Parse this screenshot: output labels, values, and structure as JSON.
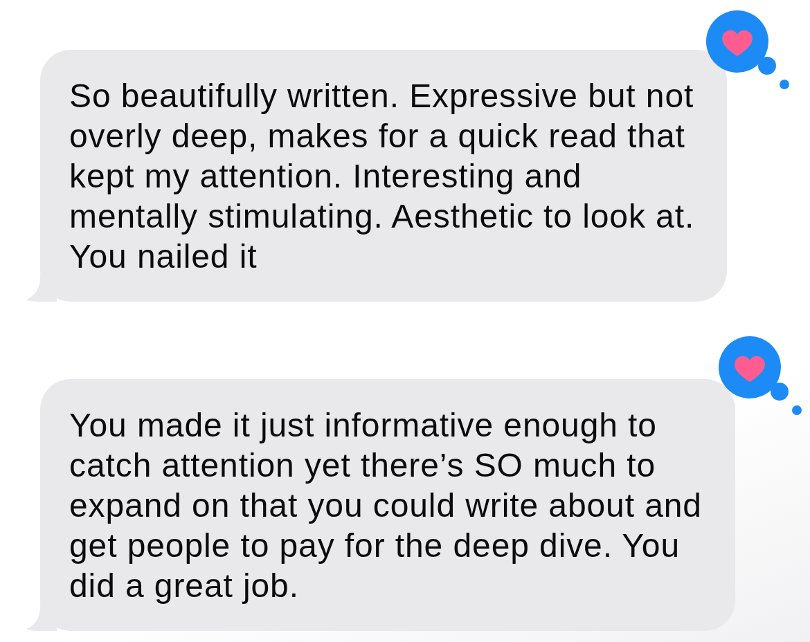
{
  "messages": [
    {
      "text": "So beautifully written. Expressive but not overly deep, makes for a quick read that kept my attention. Interesting and mentally stimulating. Aesthetic to look at. You nailed it",
      "hearted": true
    },
    {
      "text": "You made it just informative enough to catch attention yet there’s SO much to expand on that you could write about and get people to pay for the deep dive. You did a great job.",
      "hearted": true
    }
  ]
}
